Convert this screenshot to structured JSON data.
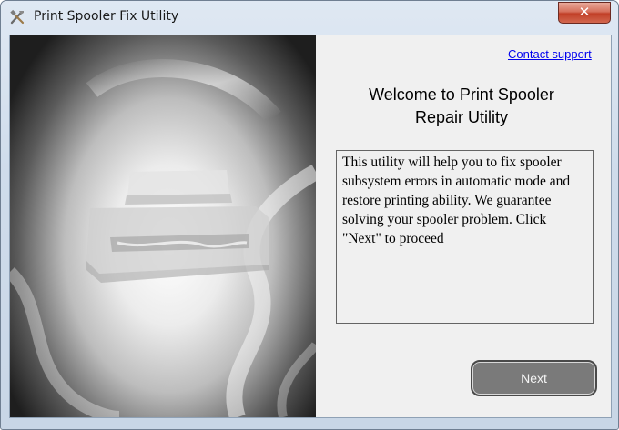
{
  "window": {
    "title": "Print Spooler Fix Utility",
    "close_label": "✕"
  },
  "links": {
    "contact_support": "Contact support"
  },
  "welcome": {
    "line1": "Welcome to Print Spooler",
    "line2": "Repair Utility"
  },
  "description": "This utility will help you to fix spooler subsystem errors in automatic mode and restore printing ability. We guarantee solving your spooler problem. Click \"Next\" to proceed",
  "buttons": {
    "next_label": "Next"
  },
  "icons": {
    "app": "tools-icon",
    "close": "close-icon",
    "hero": "printer-illustration"
  }
}
